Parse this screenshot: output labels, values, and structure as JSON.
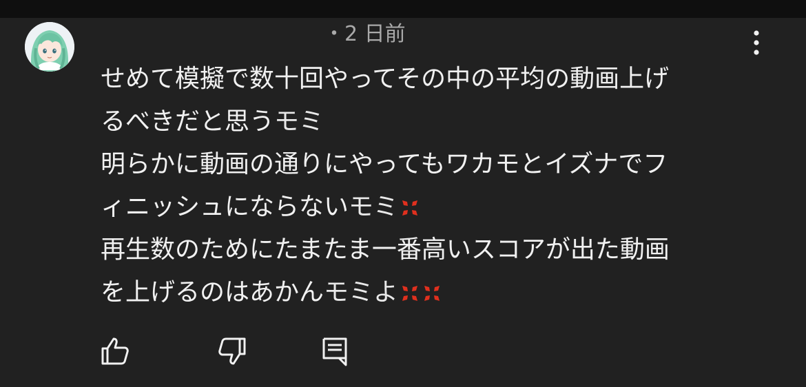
{
  "comment": {
    "meta": "・2 日前",
    "lines": [
      {
        "text": "せめて模擬で数十回やってその中の平均の動画上げ",
        "suffix": "",
        "anger_count": 0
      },
      {
        "text": "るべきだと思う",
        "suffix": "モミ",
        "anger_count": 0
      },
      {
        "text": "明らかに動画の通りにやってもワカモとイズナでフ",
        "suffix": "",
        "anger_count": 0
      },
      {
        "text": "ィニッシュにならない",
        "suffix": "モミ",
        "anger_count": 1
      },
      {
        "text": "再生数のためにたまたま一番高いスコアが出た動画",
        "suffix": "",
        "anger_count": 0
      },
      {
        "text": "を上げるのはあかん",
        "suffix": "モミよ",
        "anger_count": 2
      }
    ]
  },
  "icons": {
    "avatar": "avatar",
    "menu": "more-vert-icon",
    "anger": "anger-symbol-icon",
    "like": "thumbs-up-icon",
    "dislike": "thumbs-down-icon",
    "reply": "reply-comment-icon"
  },
  "colors": {
    "background": "#212121",
    "topbar": "#0f0f0f",
    "text": "#f1f1f1",
    "meta": "#aaaaaa",
    "anger": "#e0301e"
  }
}
